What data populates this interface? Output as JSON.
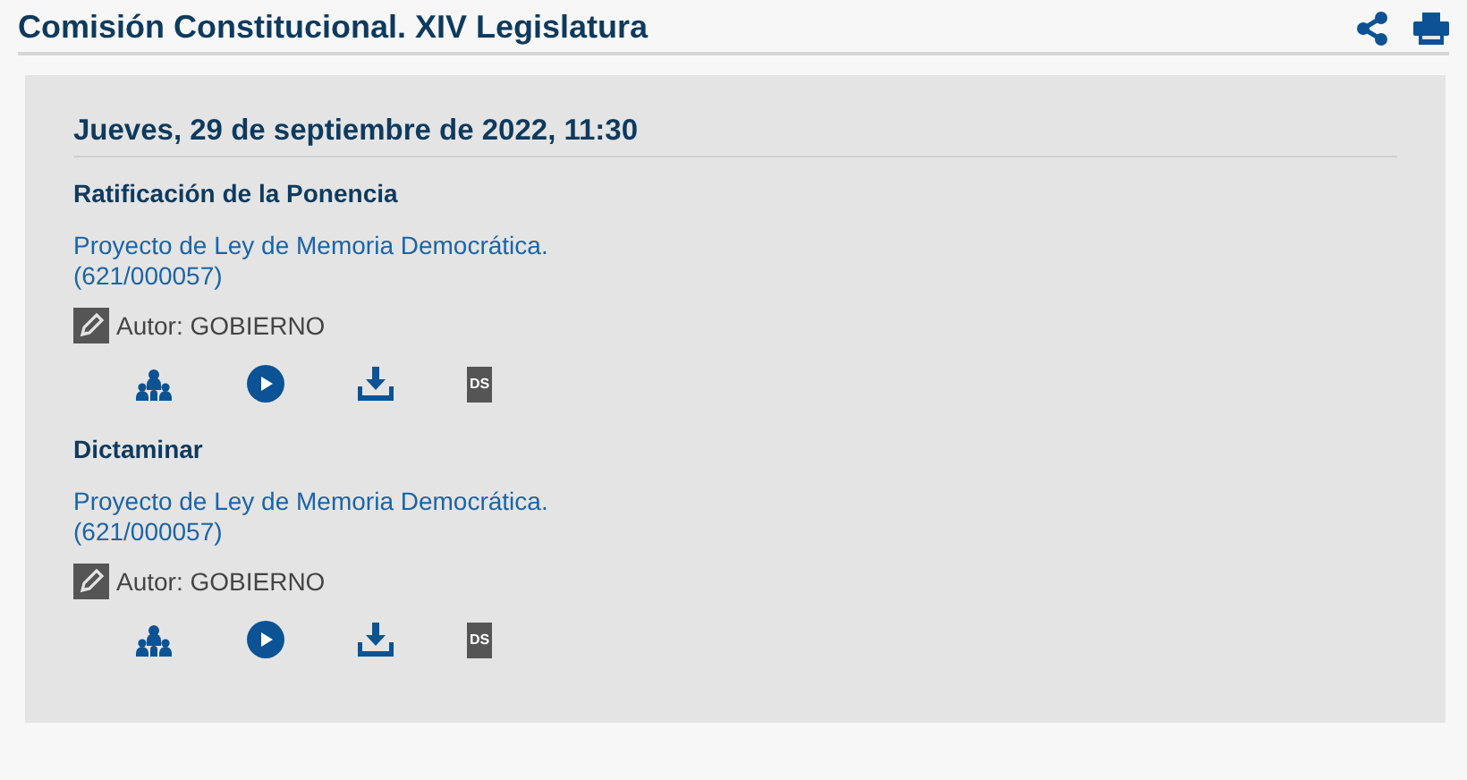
{
  "header": {
    "title": "Comisión Constitucional. XIV Legislatura"
  },
  "session": {
    "date": "Jueves, 29 de septiembre de 2022, 11:30",
    "items": [
      {
        "heading": "Ratificación de la Ponencia",
        "link_lines": [
          "Proyecto de Ley de Memoria Democrática.",
          "(621/000057)"
        ],
        "author": "Autor: GOBIERNO",
        "ds_label": "DS"
      },
      {
        "heading": "Dictaminar",
        "link_lines": [
          "Proyecto de Ley de Memoria Democrática.",
          "(621/000057)"
        ],
        "author": "Autor: GOBIERNO",
        "ds_label": "DS"
      }
    ]
  }
}
